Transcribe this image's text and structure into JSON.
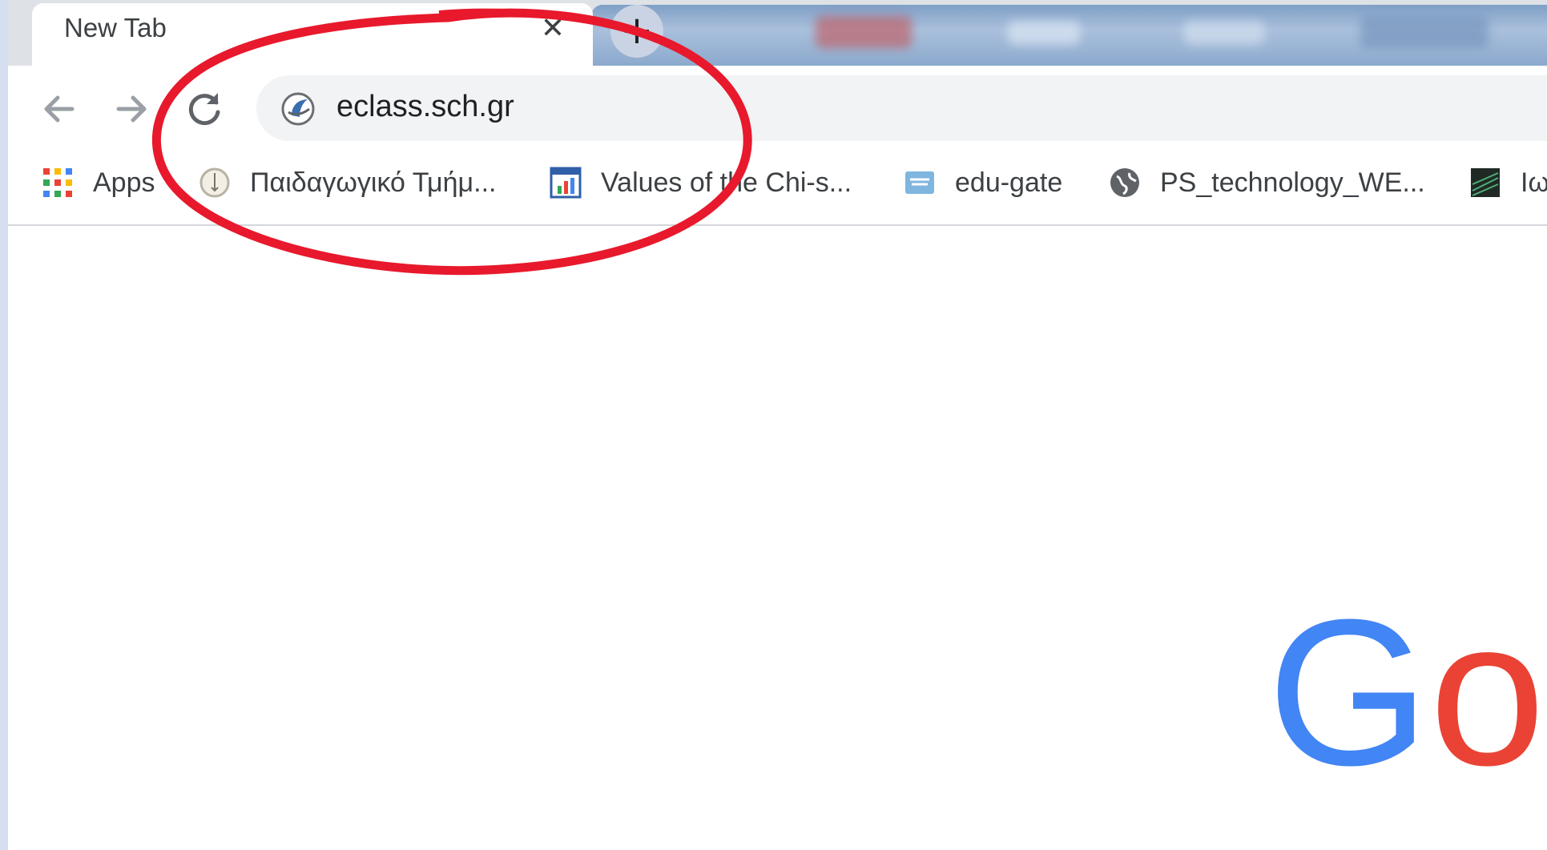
{
  "browser": {
    "tab": {
      "title": "New Tab",
      "close_label": "✕"
    },
    "new_tab_label": "+",
    "omnibox": {
      "url": "eclass.sch.gr"
    }
  },
  "bookmarks": [
    {
      "label": "Apps",
      "icon": "apps-grid-icon"
    },
    {
      "label": "Παιδαγωγικό Τμήμ...",
      "icon": "university-seal-icon"
    },
    {
      "label": "Values of the Chi-s...",
      "icon": "spreadsheet-chart-icon"
    },
    {
      "label": "edu-gate",
      "icon": "edu-gate-icon"
    },
    {
      "label": "PS_technology_WE...",
      "icon": "globe-icon"
    },
    {
      "label": "Ιω",
      "icon": "dark-image-icon"
    }
  ],
  "google_logo": {
    "letters": [
      "G",
      "o"
    ],
    "colors": [
      "#4285f4",
      "#ea4335"
    ]
  },
  "annotation": {
    "color": "#e8192c",
    "shape": "ellipse"
  }
}
